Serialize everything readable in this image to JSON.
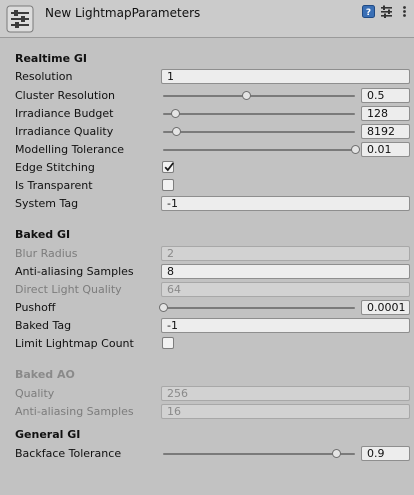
{
  "header": {
    "title": "New LightmapParameters",
    "icons": [
      "help-icon",
      "preset-settings-icon",
      "more-options-icon"
    ]
  },
  "sections": {
    "realtime": {
      "title": "Realtime GI",
      "resolution": {
        "label": "Resolution",
        "value": "1"
      },
      "cluster_resolution": {
        "label": "Cluster Resolution",
        "value": "0.5",
        "slider": 0.43
      },
      "irradiance_budget": {
        "label": "Irradiance Budget",
        "value": "128",
        "slider": 0.06
      },
      "irradiance_quality": {
        "label": "Irradiance Quality",
        "value": "8192",
        "slider": 0.07
      },
      "modelling_tolerance": {
        "label": "Modelling Tolerance",
        "value": "0.01",
        "slider": 1.0
      },
      "edge_stitching": {
        "label": "Edge Stitching",
        "checked": true
      },
      "is_transparent": {
        "label": "Is Transparent",
        "checked": false
      },
      "system_tag": {
        "label": "System Tag",
        "value": "-1"
      }
    },
    "baked": {
      "title": "Baked GI",
      "blur_radius": {
        "label": "Blur Radius",
        "value": "2"
      },
      "aa_samples": {
        "label": "Anti-aliasing Samples",
        "value": "8"
      },
      "direct_light_quality": {
        "label": "Direct Light Quality",
        "value": "64"
      },
      "pushoff": {
        "label": "Pushoff",
        "value": "0.0001",
        "slider": 0.0
      },
      "baked_tag": {
        "label": "Baked Tag",
        "value": "-1"
      },
      "limit_lightmap_count": {
        "label": "Limit Lightmap Count",
        "checked": false
      }
    },
    "baked_ao": {
      "title": "Baked AO",
      "quality": {
        "label": "Quality",
        "value": "256"
      },
      "aa_samples": {
        "label": "Anti-aliasing Samples",
        "value": "16"
      }
    },
    "general": {
      "title": "General GI",
      "backface_tolerance": {
        "label": "Backface Tolerance",
        "value": "0.9",
        "slider": 0.9
      }
    }
  }
}
